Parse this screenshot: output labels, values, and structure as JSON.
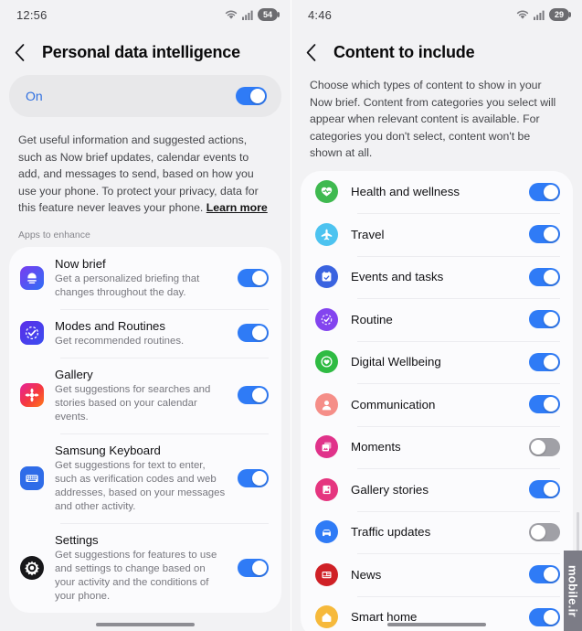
{
  "left": {
    "status": {
      "time": "12:56",
      "battery": "54",
      "wifi_icon": "wifi-icon",
      "signal_icon": "signal-bars-icon"
    },
    "title": "Personal data intelligence",
    "back_icon": "chevron-left-icon",
    "master": {
      "label": "On",
      "state": "on"
    },
    "description_before": "Get useful information and suggested actions, such as Now brief updates, calendar events to add, and messages to send, based on how you use your phone. To protect your privacy, data for this feature never leaves your phone. ",
    "learn_more": "Learn more",
    "section_label": "Apps to enhance",
    "apps": [
      {
        "title": "Now brief",
        "sub": "Get a personalized briefing that changes throughout the day.",
        "state": "on",
        "icon": "now-brief-icon"
      },
      {
        "title": "Modes and Routines",
        "sub": "Get recommended routines.",
        "state": "on",
        "icon": "modes-routines-icon"
      },
      {
        "title": "Gallery",
        "sub": "Get suggestions for searches and stories based on your calendar events.",
        "state": "on",
        "icon": "gallery-icon"
      },
      {
        "title": "Samsung Keyboard",
        "sub": "Get suggestions for text to enter, such as verification codes and web addresses, based on your messages and other activity.",
        "state": "on",
        "icon": "keyboard-icon"
      },
      {
        "title": "Settings",
        "sub": "Get suggestions for features to use and settings to change based on your activity and the conditions of your phone.",
        "state": "on",
        "icon": "settings-gear-icon"
      }
    ]
  },
  "right": {
    "status": {
      "time": "4:46",
      "battery": "29",
      "wifi_icon": "wifi-icon",
      "signal_icon": "signal-bars-icon"
    },
    "title": "Content to include",
    "back_icon": "chevron-left-icon",
    "description": "Choose which types of content to show in your Now brief. Content from categories you select will appear when relevant content is available. For categories you don't select, content won't be shown at all.",
    "items": [
      {
        "label": "Health and wellness",
        "state": "on",
        "icon": "heart-health-icon",
        "color": "#3fb950"
      },
      {
        "label": "Travel",
        "state": "on",
        "icon": "airplane-icon",
        "color": "#4dc3f0"
      },
      {
        "label": "Events and tasks",
        "state": "on",
        "icon": "calendar-check-icon",
        "color": "#3a63e0"
      },
      {
        "label": "Routine",
        "state": "on",
        "icon": "routine-check-icon",
        "color": "#8344ef"
      },
      {
        "label": "Digital Wellbeing",
        "state": "on",
        "icon": "wellbeing-shield-icon",
        "color": "#2fbb43"
      },
      {
        "label": "Communication",
        "state": "on",
        "icon": "person-icon",
        "color": "#f58e88"
      },
      {
        "label": "Moments",
        "state": "off",
        "icon": "moments-photos-icon",
        "color": "#e0328a"
      },
      {
        "label": "Gallery stories",
        "state": "on",
        "icon": "gallery-story-icon",
        "color": "#e5357f"
      },
      {
        "label": "Traffic updates",
        "state": "off",
        "icon": "car-icon",
        "color": "#2f7bf6"
      },
      {
        "label": "News",
        "state": "on",
        "icon": "news-icon",
        "color": "#cf2026"
      },
      {
        "label": "Smart home",
        "state": "on",
        "icon": "smart-home-icon",
        "color": "#f6b93b"
      }
    ]
  },
  "watermark": "mobile.ir",
  "colors": {
    "toggle_on": "#2f7bf6",
    "toggle_off": "#a0a0a6",
    "accent_text": "#2f6fe0",
    "bg": "#f2f2f4",
    "card": "#fbfbfd"
  }
}
